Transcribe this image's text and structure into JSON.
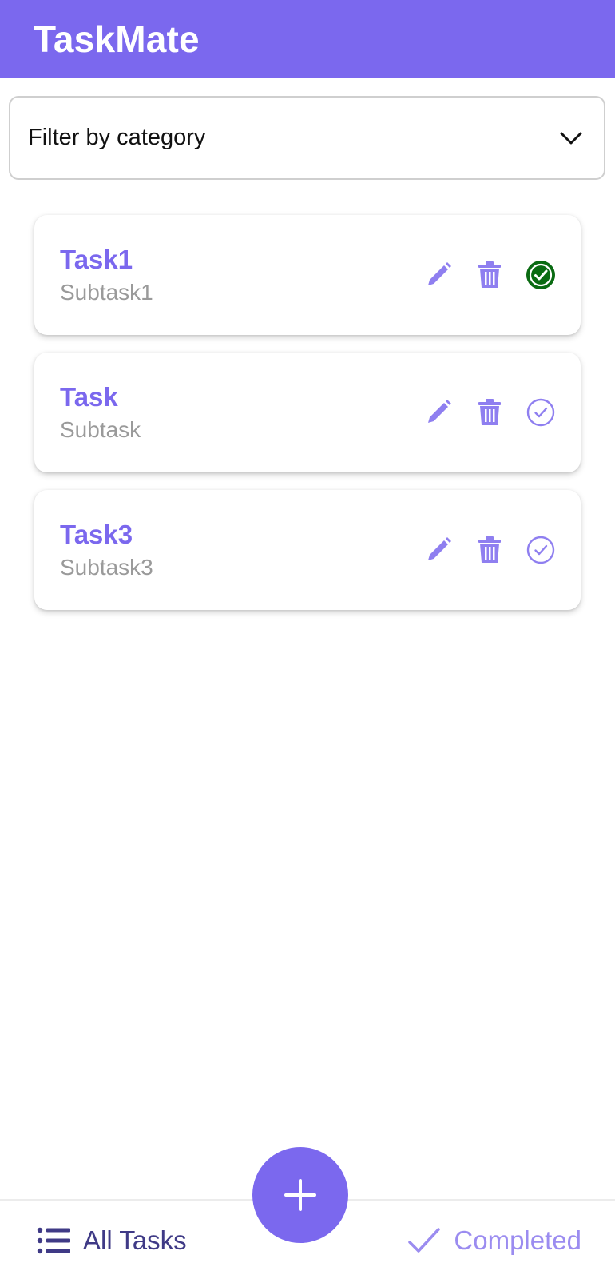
{
  "app": {
    "title": "TaskMate"
  },
  "filter": {
    "label": "Filter by category",
    "icon": "chevron-down-icon"
  },
  "tasks": [
    {
      "title": "Task1",
      "subtitle": "Subtask1",
      "completed": true
    },
    {
      "title": "Task",
      "subtitle": "Subtask",
      "completed": false
    },
    {
      "title": "Task3",
      "subtitle": "Subtask3",
      "completed": false
    }
  ],
  "bottom_nav": {
    "all_tasks_label": "All Tasks",
    "completed_label": "Completed",
    "all_tasks_icon": "list-icon",
    "completed_icon": "check-icon",
    "add_icon": "plus-icon"
  },
  "colors": {
    "primary": "#7b68ee",
    "completed_green": "#0a6b12",
    "subtitle_gray": "#9a9a9a",
    "nav_dark": "#3f3a86",
    "nav_light": "#9b8cf0"
  }
}
